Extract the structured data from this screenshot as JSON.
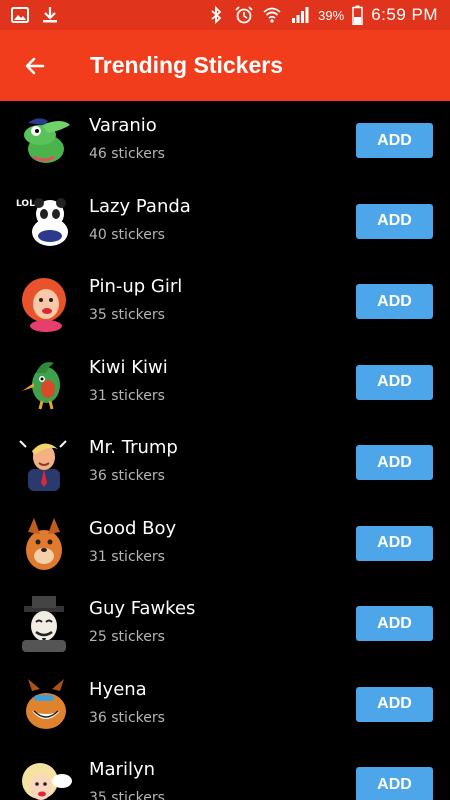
{
  "status_bar": {
    "icons": [
      "image-icon",
      "download-icon",
      "bluetooth-icon",
      "alarm-icon",
      "wifi-icon",
      "signal-icon"
    ],
    "battery": "39%",
    "time": "6:59 PM",
    "background": "#e0341c"
  },
  "toolbar": {
    "title": "Trending Stickers",
    "back_icon": "arrow-left-icon",
    "background": "#f23d1c"
  },
  "accent": "#4ea6ea",
  "stickers": [
    {
      "name": "Varanio",
      "count": "46 stickers",
      "add_label": "ADD"
    },
    {
      "name": "Lazy Panda",
      "count": "40 stickers",
      "add_label": "ADD"
    },
    {
      "name": "Pin-up Girl",
      "count": "35 stickers",
      "add_label": "ADD"
    },
    {
      "name": "Kiwi Kiwi",
      "count": "31 stickers",
      "add_label": "ADD"
    },
    {
      "name": "Mr. Trump",
      "count": "36 stickers",
      "add_label": "ADD"
    },
    {
      "name": "Good Boy",
      "count": "31 stickers",
      "add_label": "ADD"
    },
    {
      "name": "Guy Fawkes",
      "count": "25 stickers",
      "add_label": "ADD"
    },
    {
      "name": "Hyena",
      "count": "36 stickers",
      "add_label": "ADD"
    },
    {
      "name": "Marilyn",
      "count": "35 stickers",
      "add_label": "ADD"
    }
  ]
}
